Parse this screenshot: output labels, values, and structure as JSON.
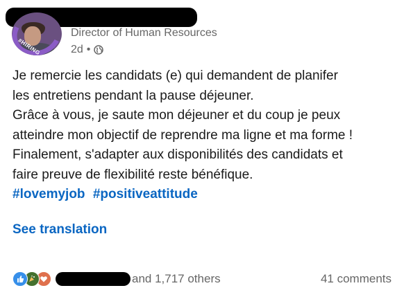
{
  "author": {
    "avatar_badge": "#HIRING",
    "headline": "Director of Human Resources",
    "time": "2d",
    "separator": "•",
    "visibility_icon": "globe-icon"
  },
  "post": {
    "lines": [
      "Je remercie les candidats (e) qui demandent de planifer",
      "les entretiens pendant la pause déjeuner.",
      "Grâce à vous, je saute mon déjeuner et du coup je peux",
      "atteindre mon objectif de reprendre ma ligne et ma forme !",
      "Finalement, s'adapter aux disponibilités des candidats et",
      "faire preuve de flexibilité reste bénéfique."
    ],
    "hashtags": [
      "#lovemyjob",
      "#positiveattitude"
    ]
  },
  "see_translation": "See translation",
  "social": {
    "reaction_icons": [
      "like-icon",
      "celebrate-icon",
      "love-icon"
    ],
    "reactions_text": "and 1,717 others",
    "comments_text": "41 comments"
  },
  "colors": {
    "link": "#0a66c2",
    "muted": "#666666",
    "avatar_ring": "#8b5cc6"
  }
}
